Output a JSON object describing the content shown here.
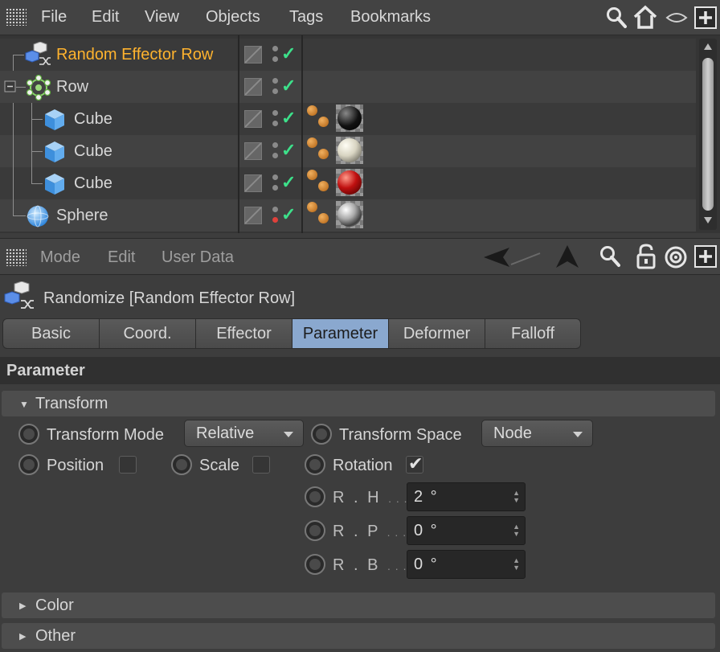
{
  "menubar": {
    "items": [
      "File",
      "Edit",
      "View",
      "Objects",
      "Tags",
      "Bookmarks"
    ]
  },
  "objects": [
    {
      "name": "Random Effector Row",
      "icon": "random-effector-icon",
      "active": true,
      "dot": "grey",
      "material": null
    },
    {
      "name": "Row",
      "icon": "cloner-icon",
      "active": false,
      "dot": "grey",
      "material": null
    },
    {
      "name": "Cube",
      "icon": "cube-icon",
      "active": false,
      "dot": "grey",
      "material": "#1a1a1a"
    },
    {
      "name": "Cube",
      "icon": "cube-icon",
      "active": false,
      "dot": "grey",
      "material": "#e8e4d6"
    },
    {
      "name": "Cube",
      "icon": "cube-icon",
      "active": false,
      "dot": "grey",
      "material": "#b01010"
    },
    {
      "name": "Sphere",
      "icon": "sphere-icon",
      "active": false,
      "dot": "red",
      "material": "#a8a8a8"
    }
  ],
  "attributes": {
    "menu": [
      "Mode",
      "Edit",
      "User Data"
    ],
    "object_title": "Randomize [Random Effector Row]",
    "tabs": [
      "Basic",
      "Coord.",
      "Effector",
      "Parameter",
      "Deformer",
      "Falloff"
    ],
    "active_tab": "Parameter",
    "section": "Parameter",
    "transform_group": "Transform",
    "transform_mode_label": "Transform Mode",
    "transform_mode_value": "Relative",
    "transform_space_label": "Transform Space",
    "transform_space_value": "Node",
    "position_label": "Position",
    "position_checked": false,
    "scale_label": "Scale",
    "scale_checked": false,
    "rotation_label": "Rotation",
    "rotation_checked": true,
    "rh_label": "R . H",
    "rh_value": "2 °",
    "rp_label": "R . P",
    "rp_value": "0 °",
    "rb_label": "R . B",
    "rb_value": "0 °",
    "field_dots": ". . .",
    "color_group": "Color",
    "other_group": "Other"
  },
  "colors": {
    "active_object": "#ffb32e",
    "active_tab": "#8aa8cf",
    "check": "#3de08a"
  }
}
